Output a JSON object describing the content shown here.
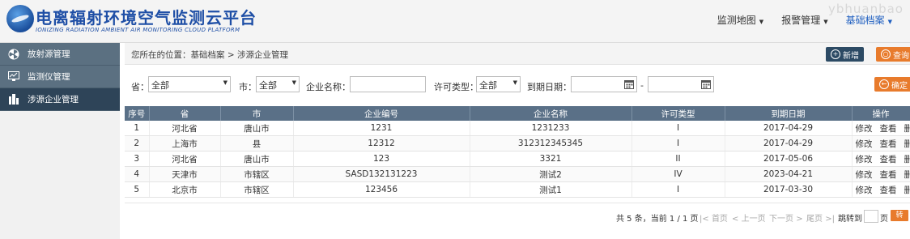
{
  "header": {
    "title": "电离辐射环境空气监测云平台",
    "subtitle": "IONIZING RADIATION AMBIENT AIR MONITORING CLOUD PLATFORM",
    "watermark": "ybhuanbao",
    "nav": [
      {
        "label": "监测地图",
        "active": false
      },
      {
        "label": "报警管理",
        "active": false
      },
      {
        "label": "基础档案",
        "active": true
      }
    ]
  },
  "sidebar": {
    "items": [
      {
        "label": "放射源管理",
        "icon": "radiation-icon",
        "active": false
      },
      {
        "label": "监测仪管理",
        "icon": "monitor-icon",
        "active": false
      },
      {
        "label": "涉源企业管理",
        "icon": "building-icon",
        "active": true
      }
    ]
  },
  "breadcrumb": "您所在的位置：基础档案 > 涉源企业管理",
  "toolbar": {
    "add_label": "新增",
    "query_label": "查询"
  },
  "filters": {
    "province_label": "省：",
    "province_value": "全部",
    "city_label": "市：",
    "city_value": "全部",
    "company_label": "企业名称：",
    "company_value": "",
    "license_label": "许可类型：",
    "license_value": "全部",
    "expiry_label": "到期日期：",
    "date_separator": "-",
    "confirm_label": "确定"
  },
  "table": {
    "columns": [
      "序号",
      "省",
      "市",
      "企业编号",
      "企业名称",
      "许可类型",
      "到期日期",
      "操作"
    ],
    "ops": [
      "修改",
      "查看",
      "删"
    ],
    "rows": [
      {
        "no": "1",
        "province": "河北省",
        "city": "唐山市",
        "code": "1231",
        "name": "1231233",
        "license": "I",
        "expiry": "2017-04-29"
      },
      {
        "no": "2",
        "province": "上海市",
        "city": "县",
        "code": "12312",
        "name": "312312345345",
        "license": "I",
        "expiry": "2017-04-29"
      },
      {
        "no": "3",
        "province": "河北省",
        "city": "唐山市",
        "code": "123",
        "name": "3321",
        "license": "II",
        "expiry": "2017-05-06"
      },
      {
        "no": "4",
        "province": "天津市",
        "city": "市辖区",
        "code": "SASD132131223",
        "name": "测试2",
        "license": "IV",
        "expiry": "2023-04-21"
      },
      {
        "no": "5",
        "province": "北京市",
        "city": "市辖区",
        "code": "123456",
        "name": "测试1",
        "license": "I",
        "expiry": "2017-03-30"
      }
    ]
  },
  "pager": {
    "summary": "共 5 条，当前 1 / 1 页",
    "first": "首页",
    "prev": "上一页",
    "next": "下一页",
    "last": "尾页",
    "jump_label": "跳转到",
    "page_unit": "页",
    "go_label": "转"
  },
  "colors": {
    "brand": "#1f4fa6",
    "sidebar": "#5b7081",
    "sidebar_active": "#2e4458",
    "table_header": "#5a7087",
    "accent": "#e87b2c",
    "add_button": "#2c4a64"
  }
}
